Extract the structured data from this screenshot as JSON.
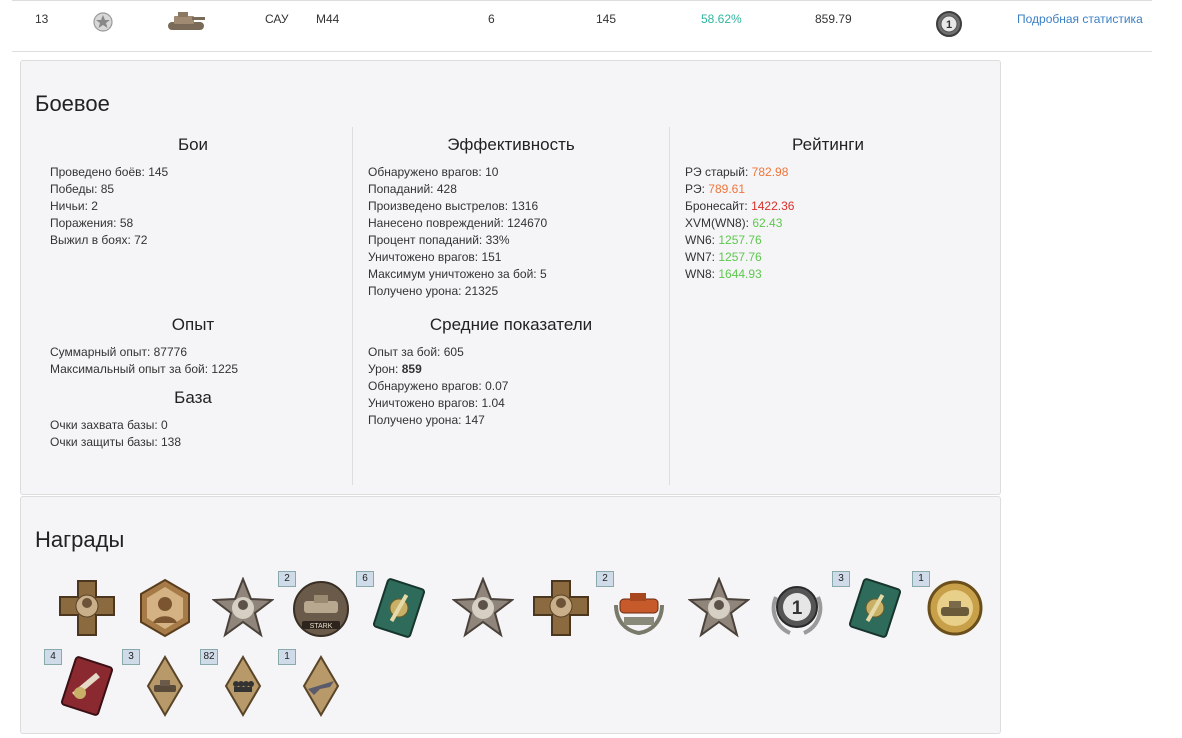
{
  "tank_row": {
    "number": "13",
    "nation_icon": "nation-star-icon",
    "tank_icon": "tank-icon",
    "type": "САУ",
    "name": "M44",
    "tier": "6",
    "battles": "145",
    "win_rate": "58.62%",
    "avg_damage": "859.79",
    "mastery_icon": "mastery-badge-1-icon",
    "link": "Подробная статистика",
    "colors": {
      "win_rate": "#2fb7a0",
      "link": "#3b7fc4"
    }
  },
  "battle": {
    "title": "Боевое",
    "fights": {
      "title": "Бои",
      "items": [
        "Проведено боёв: 145",
        "Победы: 85",
        "Ничьи: 2",
        "Поражения: 58",
        "Выжил в боях: 72"
      ]
    },
    "experience": {
      "title": "Опыт",
      "items": [
        "Суммарный опыт: 87776",
        "Максимальный опыт за бой: 1225"
      ]
    },
    "base": {
      "title": "База",
      "items": [
        "Очки захвата базы: 0",
        "Очки защиты базы: 138"
      ]
    },
    "efficiency": {
      "title": "Эффективность",
      "items": [
        "Обнаружено врагов: 10",
        "Попаданий: 428",
        "Произведено выстрелов: 1316",
        "Нанесено повреждений: 124670",
        "Процент попаданий: 33%",
        "Уничтожено врагов: 151",
        "Максимум уничтожено за бой: 5",
        "Получено урона: 21325"
      ]
    },
    "averages": {
      "title": "Средние показатели",
      "items": [
        {
          "label": "Опыт за бой: ",
          "value": "605"
        },
        {
          "label": "Урон: ",
          "value": "859"
        },
        {
          "label": "Обнаружено врагов: ",
          "value": "0.07"
        },
        {
          "label": "Уничтожено врагов: ",
          "value": "1.04"
        },
        {
          "label": "Получено урона: ",
          "value": "147"
        }
      ]
    },
    "ratings": {
      "title": "Рейтинги",
      "items": [
        {
          "label": "РЭ старый: ",
          "value": "782.98",
          "color": "#f0753a"
        },
        {
          "label": "РЭ: ",
          "value": "789.61",
          "color": "#f0753a"
        },
        {
          "label": "Бронесайт: ",
          "value": "1422.36",
          "color": "#d9302b"
        },
        {
          "label": "XVM(WN8): ",
          "value": "62.43",
          "color": "#5ec84e"
        },
        {
          "label": "WN6: ",
          "value": "1257.76",
          "color": "#5ec84e"
        },
        {
          "label": "WN7: ",
          "value": "1257.76",
          "color": "#5ec84e"
        },
        {
          "label": "WN8: ",
          "value": "1644.93",
          "color": "#5ec84e"
        }
      ]
    }
  },
  "awards": {
    "title": "Награды",
    "items": [
      {
        "icon": "cross-medal-icon",
        "count": ""
      },
      {
        "icon": "hexagon-portrait-medal-icon",
        "count": ""
      },
      {
        "icon": "star-portrait-medal-icon",
        "count": ""
      },
      {
        "icon": "stark-tank-medal-icon",
        "count": "2"
      },
      {
        "icon": "green-card-medal-icon",
        "count": "6"
      },
      {
        "icon": "star-portrait-medal-icon",
        "count": ""
      },
      {
        "icon": "cross-medal-icon",
        "count": ""
      },
      {
        "icon": "tank-wreath-medal-icon",
        "count": "2"
      },
      {
        "icon": "star-portrait-medal-icon",
        "count": ""
      },
      {
        "icon": "mastery-class-1-icon",
        "count": ""
      },
      {
        "icon": "green-card-medal-icon",
        "count": "3"
      },
      {
        "icon": "gold-tank-medal-icon",
        "count": "1"
      },
      {
        "icon": "red-card-medal-icon",
        "count": "4"
      },
      {
        "icon": "diamond-tank-medal-icon",
        "count": "3"
      },
      {
        "icon": "diamond-knuckles-medal-icon",
        "count": "82"
      },
      {
        "icon": "diamond-plane-medal-icon",
        "count": "1"
      }
    ],
    "mastery_label": "1",
    "stark_label": "STARK"
  }
}
